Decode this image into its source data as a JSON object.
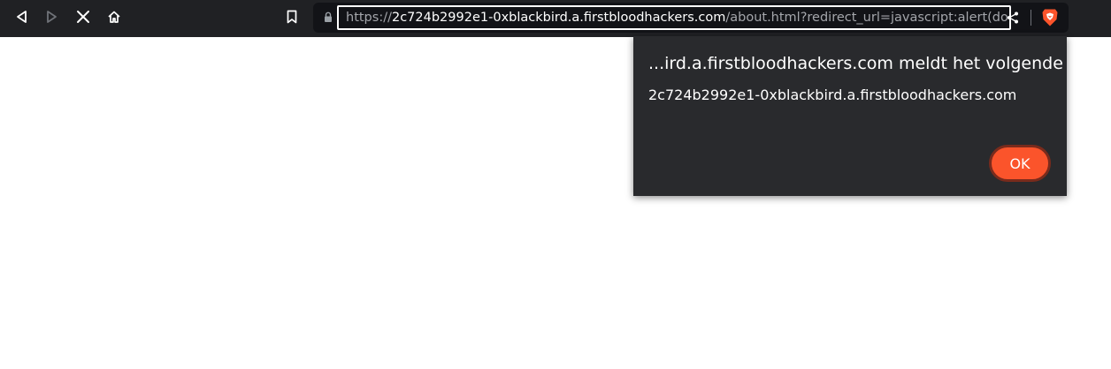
{
  "browser": {
    "nav": {
      "back_icon": "back-icon",
      "forward_icon": "forward-icon",
      "stop_icon": "stop-loading-icon",
      "home_icon": "home-icon"
    },
    "bookmark_icon": "bookmark-icon",
    "address_bar": {
      "scheme": "https://",
      "host": "2c724b2992e1-0xblackbird.a.firstbloodhackers.com",
      "path": "/about.html?redirect_url=javascript:alert(docu..."
    },
    "share_icon": "share-icon",
    "brave_icon": "brave-shields-icon"
  },
  "dialog": {
    "title": "...ird.a.firstbloodhackers.com meldt het volgende",
    "message": "2c724b2992e1-0xblackbird.a.firstbloodhackers.com",
    "ok_label": "OK"
  },
  "colors": {
    "toolbar_bg": "#202124",
    "urlbar_bg": "#121317",
    "dialog_bg": "#292a2d",
    "ok_button": "#fb542b",
    "brave_orange": "#fb542b"
  }
}
